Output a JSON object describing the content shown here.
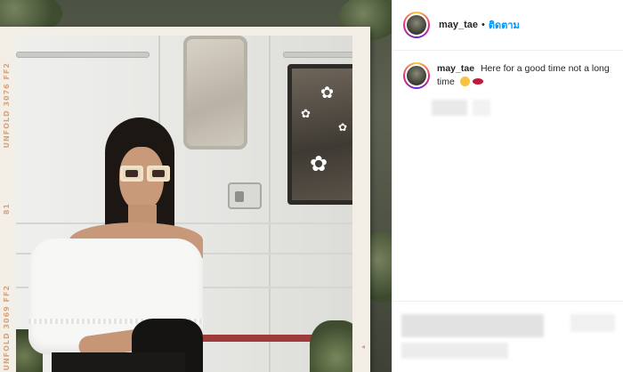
{
  "photo": {
    "film_text_top": "UNFOLD 3076 FF2",
    "film_text_mid": "81",
    "film_text_bottom": "UNFOLD 3069 FF2"
  },
  "post": {
    "author": {
      "username": "may_tae",
      "separator": "•",
      "follow_label": "ติดตาม"
    },
    "caption": {
      "username": "may_tae",
      "text": "Here for a good time not a long time",
      "emojis": [
        "clapping-hands-emoji",
        "lips-emoji"
      ]
    }
  },
  "colors": {
    "follow_blue": "#0095f6",
    "text": "#262626",
    "divider": "#efefef"
  }
}
